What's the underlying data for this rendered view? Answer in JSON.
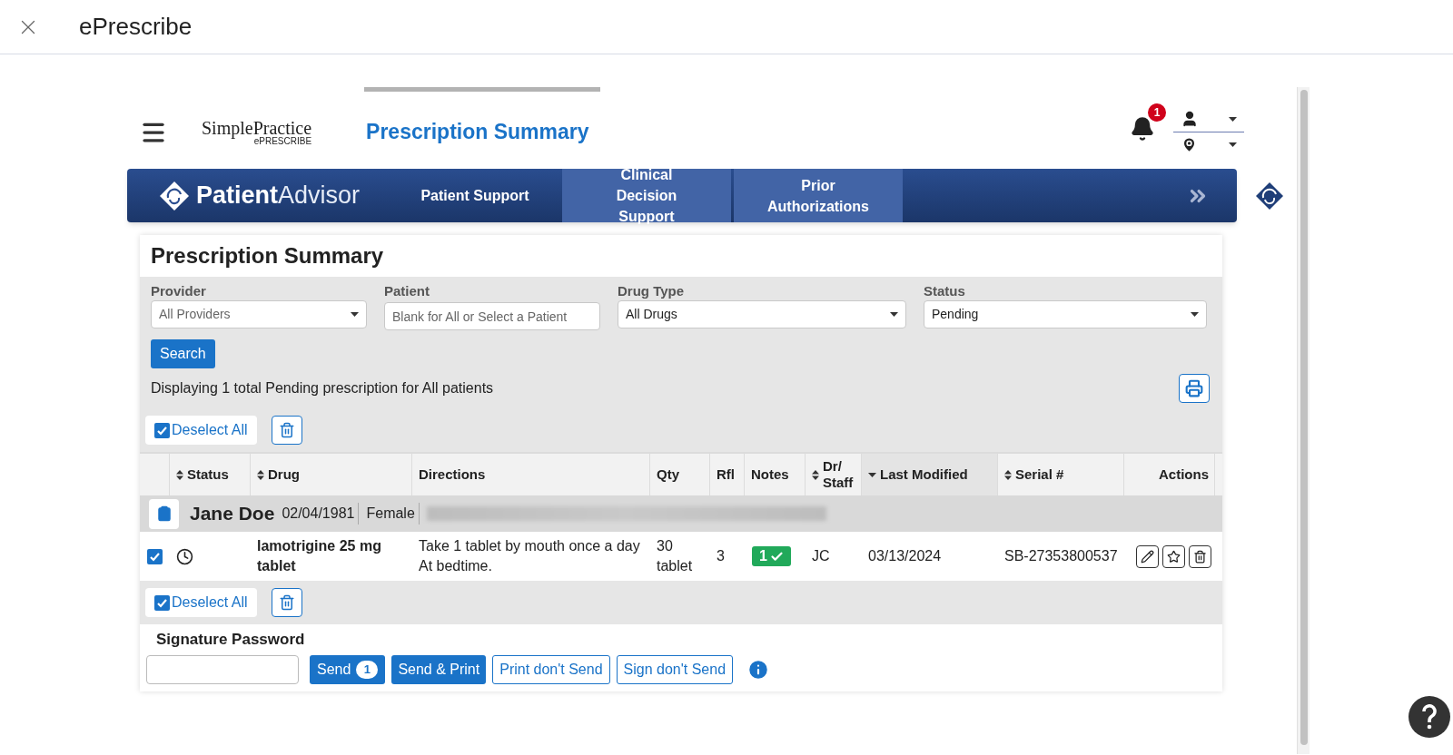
{
  "window": {
    "title": "ePrescribe"
  },
  "header": {
    "logo_name": "SimplePractice",
    "logo_sub": "ePRESCRIBE",
    "title": "Prescription Summary",
    "notifications": "1"
  },
  "nav": {
    "brand_bold": "Patient",
    "brand_light": "Advisor",
    "tabs": [
      {
        "label": "Patient Support",
        "highlighted": false
      },
      {
        "label": "Clinical Decision Support",
        "highlighted": true
      },
      {
        "label": "Prior Authorizations",
        "highlighted": true
      }
    ]
  },
  "summary": {
    "title": "Prescription Summary",
    "filters": [
      {
        "label": "Provider",
        "kind": "select",
        "value": "All Providers",
        "muted": true
      },
      {
        "label": "Patient",
        "kind": "input",
        "placeholder": "Blank for All or Select a Patient"
      },
      {
        "label": "Drug Type",
        "kind": "select",
        "value": "All Drugs",
        "muted": false
      },
      {
        "label": "Status",
        "kind": "select",
        "value": "Pending",
        "muted": false
      }
    ],
    "search_button": "Search",
    "result_text": "Displaying 1 total Pending prescription for All patients",
    "deselect_top": "Deselect All",
    "deselect_bottom": "Deselect All",
    "columns": [
      {
        "label": "Status",
        "sortable": true,
        "sorted": false
      },
      {
        "label": "Drug",
        "sortable": true,
        "sorted": false
      },
      {
        "label": "Directions",
        "sortable": false,
        "sorted": false
      },
      {
        "label": "Qty",
        "sortable": false,
        "sorted": false
      },
      {
        "label": "Rfl",
        "sortable": false,
        "sorted": false
      },
      {
        "label": "Notes",
        "sortable": false,
        "sorted": false
      },
      {
        "label": "Dr/ Staff",
        "sortable": true,
        "sorted": false
      },
      {
        "label": "Last Modified",
        "sortable": true,
        "sorted": true
      },
      {
        "label": "Serial #",
        "sortable": true,
        "sorted": false
      },
      {
        "label": "Actions",
        "sortable": false,
        "sorted": false
      }
    ],
    "patient": {
      "name": "Jane Doe",
      "dob": "02/04/1981",
      "sex": "Female"
    },
    "rows": [
      {
        "checked": true,
        "drug": "lamotrigine 25 mg tablet",
        "directions": "Take 1 tablet by mouth once a day At bedtime.",
        "qty": "30 tablet",
        "rfl": "3",
        "notes": "1",
        "staff": "JC",
        "modified": "03/13/2024",
        "serial": "SB-27353800537"
      }
    ],
    "signature_label": "Signature Password",
    "send": {
      "label": "Send",
      "count": "1"
    },
    "buttons": [
      "Send & Print",
      "Print don't Send",
      "Sign don't Send"
    ]
  }
}
